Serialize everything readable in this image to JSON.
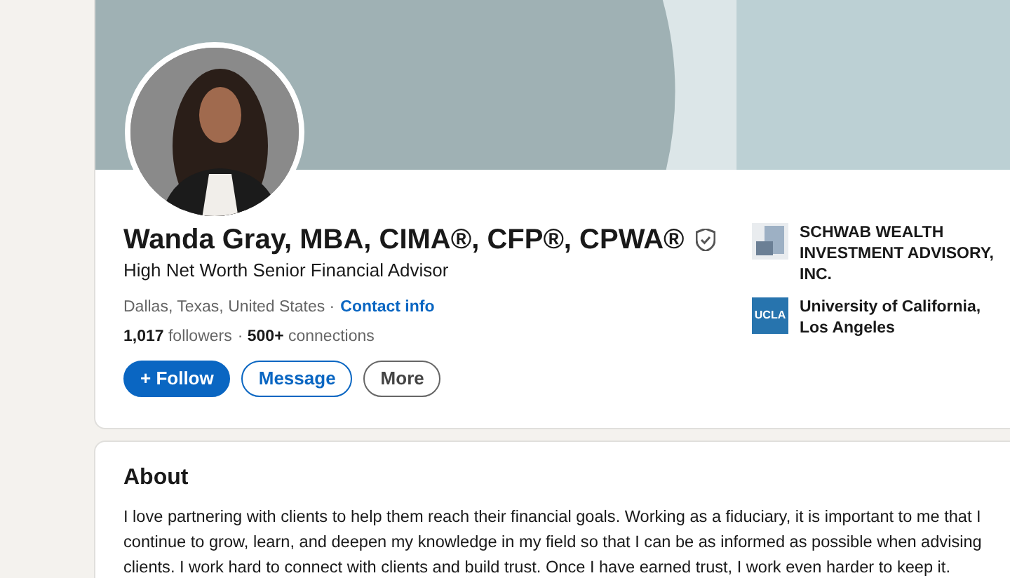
{
  "profile": {
    "name": "Wanda Gray, MBA, CIMA®, CFP®, CPWA®",
    "verified": true,
    "headline": "High Net Worth Senior Financial Advisor",
    "location": "Dallas, Texas, United States ·",
    "contact_link": "Contact info",
    "followers": "**1,017** followers",
    "connections": "· **500+** connections",
    "buttons": [
      {
        "label": "+ Follow",
        "kind": "primary"
      },
      {
        "label": "Message",
        "kind": "outline"
      },
      {
        "label": "More",
        "kind": "secondary"
      }
    ],
    "affiliations": [
      {
        "kind": "company",
        "name": "SCHWAB WEALTH INVESTMENT ADVISORY, INC."
      },
      {
        "kind": "school",
        "logo_text": "UCLA",
        "name": "University of California, Los Angeles"
      }
    ]
  },
  "about": {
    "title": "About",
    "text": "I love partnering with clients to help them reach their financial goals. Working as a fiduciary, it is important to me that I continue to grow, learn, and deepen my knowledge in my field so that I can be as informed as possible when advising clients. I work hard to connect with clients and build trust. Once I have earned trust, I work even harder to keep it."
  }
}
